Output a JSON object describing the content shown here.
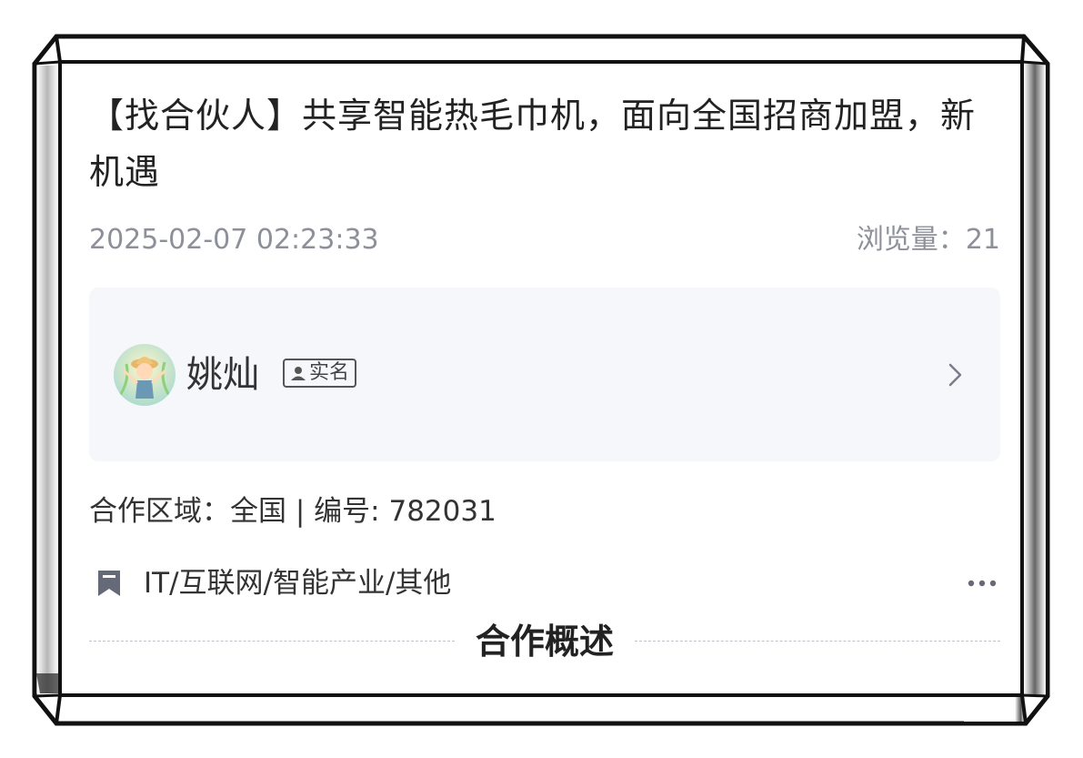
{
  "post": {
    "title": "【找合伙人】共享智能热毛巾机，面向全国招商加盟，新机遇",
    "datetime": "2025-02-07 02:23:33",
    "views_label": "浏览量：",
    "views_count": "21"
  },
  "author": {
    "name": "姚灿",
    "badge_label": "实名",
    "avatar_icon": "avatar-illustration",
    "chevron_icon": "chevron-right-icon"
  },
  "details": {
    "region_label": "合作区域：",
    "region_value": "全国",
    "separator": " | ",
    "id_label": "编号: ",
    "id_value": "782031",
    "category_icon": "bookmark-icon",
    "category": "IT/互联网/智能产业/其他",
    "more_icon": "more-icon"
  },
  "section": {
    "title": "合作概述"
  },
  "colors": {
    "text_primary": "#222222",
    "text_secondary": "#8e9099",
    "card_background": "#f6f7fb",
    "icon_gray": "#666a78",
    "frame": "#111111"
  }
}
